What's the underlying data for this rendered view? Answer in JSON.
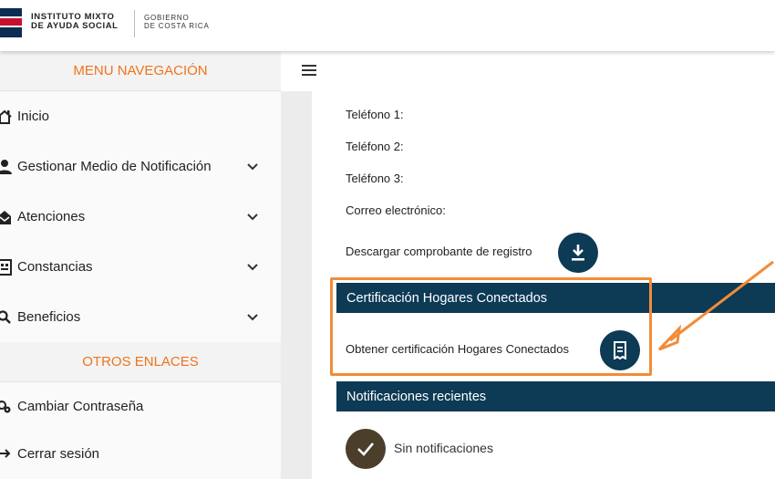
{
  "header": {
    "org_line1": "INSTITUTO MIXTO",
    "org_line2": "DE AYUDA SOCIAL",
    "gov_line1": "GOBIERNO",
    "gov_line2": "DE COSTA RICA"
  },
  "sidebar": {
    "menu_title": "MENU NAVEGACIÓN",
    "items": [
      {
        "label": "Inicio",
        "icon": "home-icon",
        "expandable": false
      },
      {
        "label": "Gestionar Medio de Notificación",
        "icon": "user-icon",
        "expandable": true
      },
      {
        "label": "Atenciones",
        "icon": "envelope-open-icon",
        "expandable": true
      },
      {
        "label": "Constancias",
        "icon": "document-icon",
        "expandable": true
      },
      {
        "label": "Beneficios",
        "icon": "search-icon",
        "expandable": true
      }
    ],
    "links_title": "OTROS ENLACES",
    "links": [
      {
        "label": "Cambiar Contraseña",
        "icon": "gear-key-icon"
      },
      {
        "label": "Cerrar sesión",
        "icon": "logout-arrow-icon"
      }
    ]
  },
  "main": {
    "fields": [
      {
        "label": "Teléfono 1:"
      },
      {
        "label": "Teléfono 2:"
      },
      {
        "label": "Teléfono 3:"
      },
      {
        "label": "Correo electrónico:"
      }
    ],
    "download_label": "Descargar comprobante de registro",
    "cert_section_title": "Certificación Hogares Conectados",
    "cert_action_label": "Obtener certificación Hogares Conectados",
    "notif_section_title": "Notificaciones recientes",
    "no_notifications": "Sin notificaciones"
  },
  "colors": {
    "accent_orange": "#f0731c",
    "band_navy": "#0d3a55",
    "highlight_orange": "#f28c38",
    "check_brown": "#4b3e2a"
  }
}
